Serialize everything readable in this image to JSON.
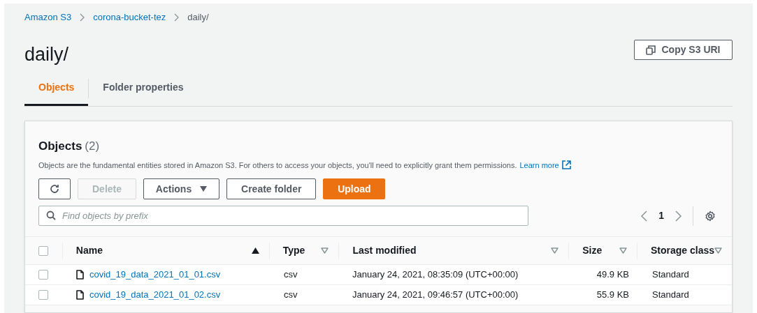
{
  "breadcrumbs": [
    {
      "label": "Amazon S3",
      "link": true
    },
    {
      "label": "corona-bucket-tez",
      "link": true
    },
    {
      "label": "daily/",
      "link": false
    }
  ],
  "title": "daily/",
  "copy_button": "Copy S3 URI",
  "tabs": [
    {
      "label": "Objects",
      "selected": true
    },
    {
      "label": "Folder properties",
      "selected": false
    }
  ],
  "panel": {
    "heading": "Objects",
    "count": "(2)",
    "description": "Objects are the fundamental entities stored in Amazon S3. For others to access your objects, you'll need to explicitly grant them permissions.",
    "learn_more": "Learn more",
    "buttons": [
      {
        "kind": "refresh",
        "disabled": false
      },
      {
        "kind": "normal",
        "label": "Delete",
        "disabled": true
      },
      {
        "kind": "dropdown",
        "label": "Actions",
        "disabled": false
      },
      {
        "kind": "normal",
        "label": "Create folder",
        "disabled": false
      },
      {
        "kind": "primary",
        "label": "Upload",
        "disabled": false
      }
    ],
    "search": {
      "placeholder": "Find objects by prefix"
    },
    "page": "1"
  },
  "table": {
    "columns": [
      {
        "label": "Name",
        "sorted": true
      },
      {
        "label": "Type",
        "sorted": false
      },
      {
        "label": "Last modified",
        "sorted": false
      },
      {
        "label": "Size",
        "sorted": false
      },
      {
        "label": "Storage class",
        "sorted": false
      }
    ],
    "select_all": {
      "checked": false
    },
    "rows": [
      {
        "checked": false,
        "name": "covid_19_data_2021_01_01.csv",
        "type": "csv",
        "modified": "January 24, 2021, 08:35:09 (UTC+00:00)",
        "size": "49.9 KB",
        "storage": "Standard"
      },
      {
        "checked": false,
        "name": "covid_19_data_2021_01_02.csv",
        "type": "csv",
        "modified": "January 24, 2021, 09:46:57 (UTC+00:00)",
        "size": "55.9 KB",
        "storage": "Standard"
      }
    ]
  }
}
